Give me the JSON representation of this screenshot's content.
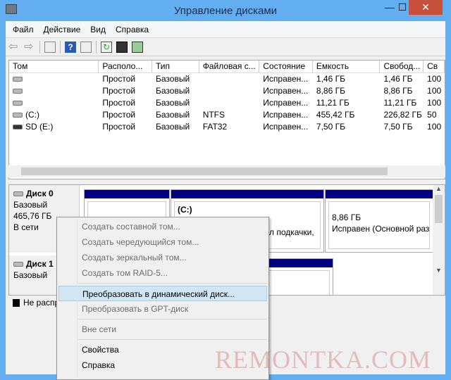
{
  "window": {
    "title": "Управление дисками",
    "minimize": "—",
    "maximize": "☐",
    "close": "✕"
  },
  "menu": [
    "Файл",
    "Действие",
    "Вид",
    "Справка"
  ],
  "toolbar": [
    "back-icon",
    "forward-icon",
    "console-tree-icon",
    "help-icon",
    "action-pane-icon",
    "refresh-icon",
    "properties-icon",
    "settings-icon"
  ],
  "columns": [
    "Том",
    "Располо...",
    "Тип",
    "Файловая с...",
    "Состояние",
    "Емкость",
    "Свобод...",
    "Св"
  ],
  "rows": [
    [
      "",
      "Простой",
      "Базовый",
      "",
      "Исправен...",
      "1,46 ГБ",
      "1,46 ГБ",
      "100"
    ],
    [
      "",
      "Простой",
      "Базовый",
      "",
      "Исправен...",
      "8,86 ГБ",
      "8,86 ГБ",
      "100"
    ],
    [
      "",
      "Простой",
      "Базовый",
      "",
      "Исправен...",
      "11,21 ГБ",
      "11,21 ГБ",
      "100"
    ],
    [
      "(C:)",
      "Простой",
      "Базовый",
      "NTFS",
      "Исправен...",
      "455,42 ГБ",
      "226,82 ГБ",
      "50"
    ],
    [
      "SD (E:)",
      "Простой",
      "Базовый",
      "FAT32",
      "Исправен...",
      "7,50 ГБ",
      "7,50 ГБ",
      "100"
    ]
  ],
  "disks": [
    {
      "name": "Диск 0",
      "type": "Базовый",
      "size": "465,76 ГБ",
      "status": "В сети"
    },
    {
      "name": "Диск 1",
      "type": "Базовый"
    }
  ],
  "partitions": {
    "c_label": "(C:)",
    "c_detail": "л подкачки,",
    "p3_size": "8,86 ГБ",
    "p3_status": "Исправен (Основной раз"
  },
  "legend": "Не распр",
  "context_menu": [
    {
      "label": "Создать составной том...",
      "disabled": true
    },
    {
      "label": "Создать чередующийся том...",
      "disabled": true
    },
    {
      "label": "Создать зеркальный том...",
      "disabled": true
    },
    {
      "label": "Создать том RAID-5...",
      "disabled": true
    },
    {
      "label": "Преобразовать в динамический диск...",
      "highlighted": true
    },
    {
      "label": "Преобразовать в GPT-диск",
      "disabled": true
    },
    {
      "label": "Вне сети",
      "disabled": true
    },
    {
      "label": "Свойства"
    },
    {
      "label": "Справка"
    }
  ],
  "watermark": "REMONTKA.COM",
  "colors": {
    "frame": "#62aef0",
    "close": "#c7503d",
    "partition_bar": "#000080",
    "highlight": "#d1e6f5"
  }
}
